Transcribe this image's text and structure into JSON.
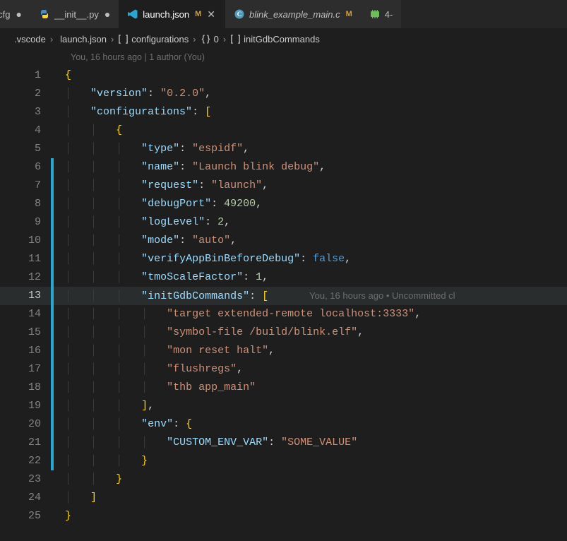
{
  "tabs": [
    {
      "label": "iltin.cfg",
      "icon": "gear-icon",
      "iconColor": "#6d6d6d",
      "modified": true,
      "active": false,
      "gitM": false,
      "partial": true
    },
    {
      "label": "__init__.py",
      "icon": "python-icon",
      "iconColor": "#4b8bbe",
      "modified": true,
      "active": false,
      "gitM": false
    },
    {
      "label": "launch.json",
      "icon": "vscode-icon",
      "iconColor": "#2aa7d0",
      "modified": false,
      "active": true,
      "gitM": true,
      "close": true
    },
    {
      "label": "blink_example_main.c",
      "icon": "c-icon",
      "iconColor": "#519aba",
      "modified": false,
      "active": false,
      "gitM": true,
      "italic": true
    },
    {
      "label": "4-",
      "icon": "pcb-icon",
      "iconColor": "#6bbf59",
      "modified": false,
      "active": false,
      "gitM": false,
      "partialRight": true
    }
  ],
  "breadcrumb": {
    "items": [
      {
        "label": ".vscode",
        "icon": null
      },
      {
        "label": "launch.json",
        "icon": "vscode-icon"
      },
      {
        "label": "configurations",
        "icon": "array-icon"
      },
      {
        "label": "0",
        "icon": "object-icon"
      },
      {
        "label": "initGdbCommands",
        "icon": "array-icon"
      }
    ]
  },
  "blame_top": "You, 16 hours ago | 1 author (You)",
  "inline_blame": "You, 16 hours ago • Uncommitted cl",
  "lines": {
    "l1": {
      "num": "1",
      "mod": false,
      "ind": 0,
      "tokens": [
        [
          "br",
          "{"
        ]
      ]
    },
    "l2": {
      "num": "2",
      "mod": false,
      "ind": 1,
      "tokens": [
        [
          "k",
          "\"version\""
        ],
        [
          "p",
          ": "
        ],
        [
          "s",
          "\"0.2.0\""
        ],
        [
          "p",
          ","
        ]
      ]
    },
    "l3": {
      "num": "3",
      "mod": false,
      "ind": 1,
      "tokens": [
        [
          "k",
          "\"configurations\""
        ],
        [
          "p",
          ": "
        ],
        [
          "br",
          "["
        ]
      ]
    },
    "l4": {
      "num": "4",
      "mod": false,
      "ind": 2,
      "tokens": [
        [
          "br",
          "{"
        ]
      ]
    },
    "l5": {
      "num": "5",
      "mod": false,
      "ind": 3,
      "tokens": [
        [
          "k",
          "\"type\""
        ],
        [
          "p",
          ": "
        ],
        [
          "s",
          "\"espidf\""
        ],
        [
          "p",
          ","
        ]
      ]
    },
    "l6": {
      "num": "6",
      "mod": true,
      "ind": 3,
      "tokens": [
        [
          "k",
          "\"name\""
        ],
        [
          "p",
          ": "
        ],
        [
          "s",
          "\"Launch blink debug\""
        ],
        [
          "p",
          ","
        ]
      ]
    },
    "l7": {
      "num": "7",
      "mod": true,
      "ind": 3,
      "tokens": [
        [
          "k",
          "\"request\""
        ],
        [
          "p",
          ": "
        ],
        [
          "s",
          "\"launch\""
        ],
        [
          "p",
          ","
        ]
      ]
    },
    "l8": {
      "num": "8",
      "mod": true,
      "ind": 3,
      "tokens": [
        [
          "k",
          "\"debugPort\""
        ],
        [
          "p",
          ": "
        ],
        [
          "n",
          "49200"
        ],
        [
          "p",
          ","
        ]
      ]
    },
    "l9": {
      "num": "9",
      "mod": true,
      "ind": 3,
      "tokens": [
        [
          "k",
          "\"logLevel\""
        ],
        [
          "p",
          ": "
        ],
        [
          "n",
          "2"
        ],
        [
          "p",
          ","
        ]
      ]
    },
    "l10": {
      "num": "10",
      "mod": true,
      "ind": 3,
      "tokens": [
        [
          "k",
          "\"mode\""
        ],
        [
          "p",
          ": "
        ],
        [
          "s",
          "\"auto\""
        ],
        [
          "p",
          ","
        ]
      ]
    },
    "l11": {
      "num": "11",
      "mod": true,
      "ind": 3,
      "tokens": [
        [
          "k",
          "\"verifyAppBinBeforeDebug\""
        ],
        [
          "p",
          ": "
        ],
        [
          "b",
          "false"
        ],
        [
          "p",
          ","
        ]
      ]
    },
    "l12": {
      "num": "12",
      "mod": true,
      "ind": 3,
      "tokens": [
        [
          "k",
          "\"tmoScaleFactor\""
        ],
        [
          "p",
          ": "
        ],
        [
          "n",
          "1"
        ],
        [
          "p",
          ","
        ]
      ]
    },
    "l13": {
      "num": "13",
      "mod": true,
      "ind": 3,
      "hl": true,
      "tokens": [
        [
          "k",
          "\"initGdbCommands\""
        ],
        [
          "p",
          ": "
        ],
        [
          "br",
          "["
        ]
      ],
      "blame": true
    },
    "l14": {
      "num": "14",
      "mod": true,
      "ind": 4,
      "tokens": [
        [
          "s",
          "\"target extended-remote localhost:3333\""
        ],
        [
          "p",
          ","
        ]
      ]
    },
    "l15": {
      "num": "15",
      "mod": true,
      "ind": 4,
      "tokens": [
        [
          "s",
          "\"symbol-file /build/blink.elf\""
        ],
        [
          "p",
          ","
        ]
      ]
    },
    "l16": {
      "num": "16",
      "mod": true,
      "ind": 4,
      "tokens": [
        [
          "s",
          "\"mon reset halt\""
        ],
        [
          "p",
          ","
        ]
      ]
    },
    "l17": {
      "num": "17",
      "mod": true,
      "ind": 4,
      "tokens": [
        [
          "s",
          "\"flushregs\""
        ],
        [
          "p",
          ","
        ]
      ]
    },
    "l18": {
      "num": "18",
      "mod": true,
      "ind": 4,
      "tokens": [
        [
          "s",
          "\"thb app_main\""
        ]
      ]
    },
    "l19": {
      "num": "19",
      "mod": true,
      "ind": 3,
      "tokens": [
        [
          "br",
          "]"
        ],
        [
          "p",
          ","
        ]
      ]
    },
    "l20": {
      "num": "20",
      "mod": true,
      "ind": 3,
      "tokens": [
        [
          "k",
          "\"env\""
        ],
        [
          "p",
          ": "
        ],
        [
          "br",
          "{"
        ]
      ]
    },
    "l21": {
      "num": "21",
      "mod": true,
      "ind": 4,
      "tokens": [
        [
          "k",
          "\"CUSTOM_ENV_VAR\""
        ],
        [
          "p",
          ": "
        ],
        [
          "s",
          "\"SOME_VALUE\""
        ]
      ]
    },
    "l22": {
      "num": "22",
      "mod": true,
      "ind": 3,
      "tokens": [
        [
          "br",
          "}"
        ]
      ]
    },
    "l23": {
      "num": "23",
      "mod": false,
      "ind": 2,
      "tokens": [
        [
          "br",
          "}"
        ]
      ]
    },
    "l24": {
      "num": "24",
      "mod": false,
      "ind": 1,
      "tokens": [
        [
          "br",
          "]"
        ]
      ]
    },
    "l25": {
      "num": "25",
      "mod": false,
      "ind": 0,
      "tokens": [
        [
          "br",
          "}"
        ]
      ]
    }
  },
  "line_order": [
    "l1",
    "l2",
    "l3",
    "l4",
    "l5",
    "l6",
    "l7",
    "l8",
    "l9",
    "l10",
    "l11",
    "l12",
    "l13",
    "l14",
    "l15",
    "l16",
    "l17",
    "l18",
    "l19",
    "l20",
    "l21",
    "l22",
    "l23",
    "l24",
    "l25"
  ]
}
